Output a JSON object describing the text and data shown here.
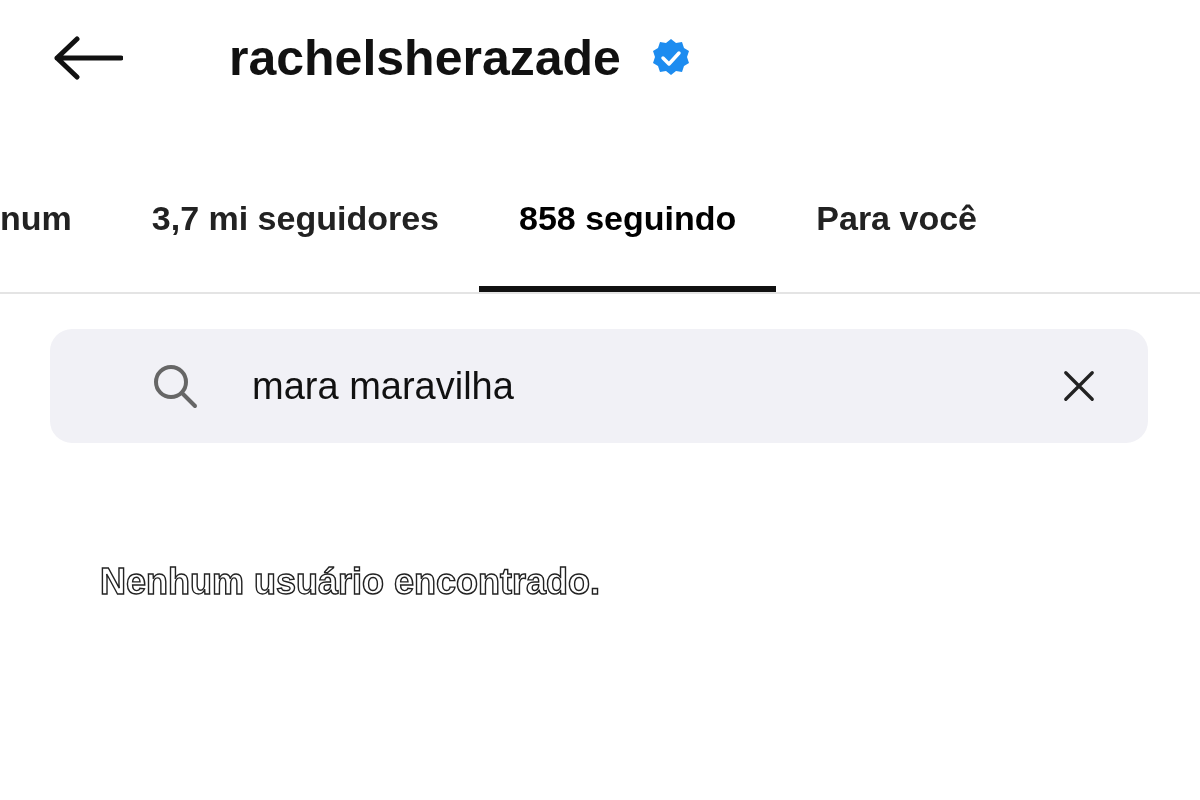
{
  "header": {
    "title": "rachelsherazade",
    "verified": true
  },
  "tabs": [
    {
      "label": "num",
      "selected": false
    },
    {
      "label": "3,7 mi seguidores",
      "selected": false
    },
    {
      "label": "858 seguindo",
      "selected": true
    },
    {
      "label": "Para você",
      "selected": false
    }
  ],
  "search": {
    "value": "mara maravilha"
  },
  "message": "Nenhum usuário encontrado."
}
